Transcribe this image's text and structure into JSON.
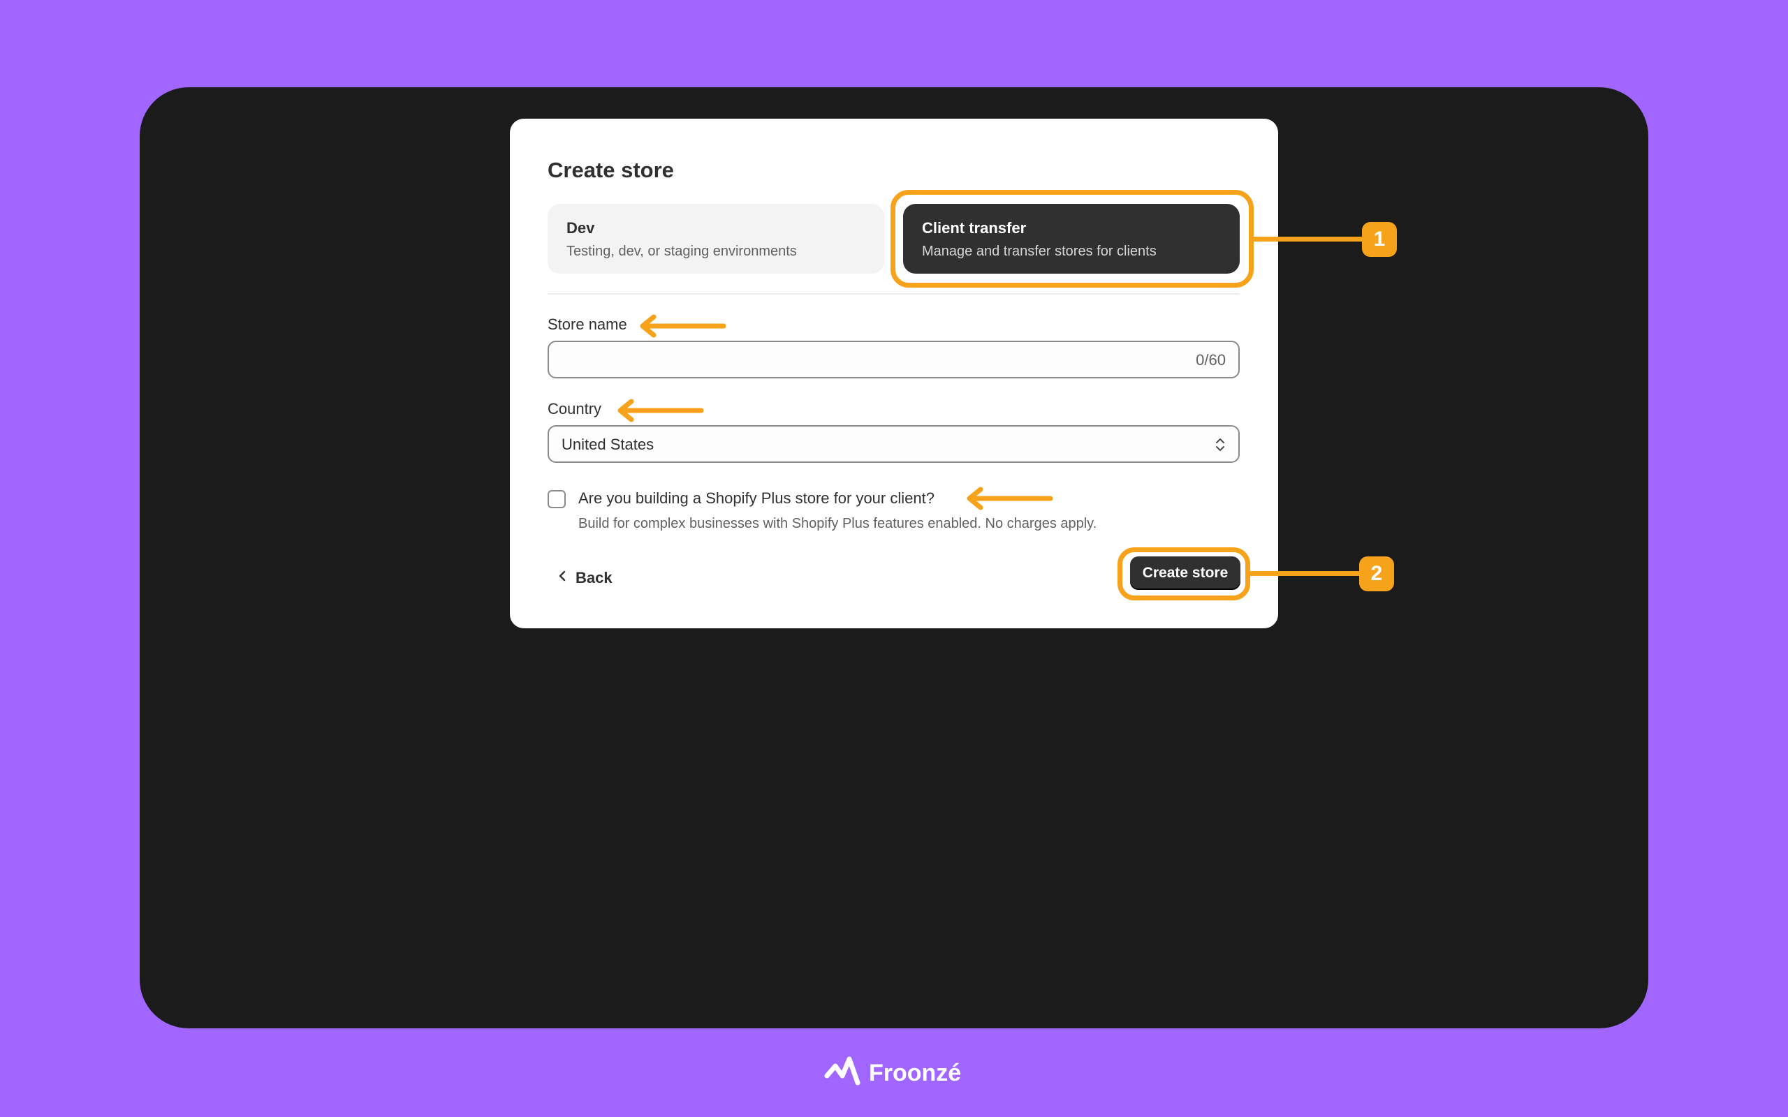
{
  "dialog": {
    "title": "Create store",
    "options": [
      {
        "title": "Dev",
        "description": "Testing, dev, or staging environments"
      },
      {
        "title": "Client transfer",
        "description": "Manage and transfer stores for clients"
      }
    ],
    "store_name": {
      "label": "Store name",
      "value": "",
      "counter": "0/60"
    },
    "country": {
      "label": "Country",
      "selected": "United States"
    },
    "plus_checkbox": {
      "label": "Are you building a Shopify Plus store for your client?",
      "help": "Build for complex businesses with Shopify Plus features enabled. No charges apply.",
      "checked": false
    },
    "back_label": "Back",
    "create_label": "Create store"
  },
  "annotations": {
    "badges": [
      "1",
      "2"
    ],
    "color": "#f7a21b"
  },
  "brand": {
    "name": "Froonzé"
  },
  "colors": {
    "background": "#a066ff",
    "frame": "#1b1b1b",
    "accent": "#f7a21b",
    "dark_button": "#303030"
  }
}
